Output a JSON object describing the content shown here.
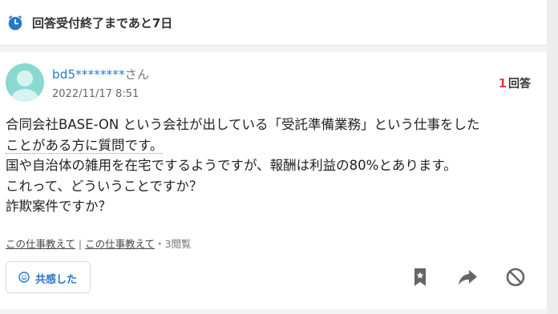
{
  "deadline": {
    "text": "回答受付終了まであと7日",
    "icon": "alarm-clock-icon",
    "icon_color": "#2878c8"
  },
  "question": {
    "user_name": "bd5********",
    "user_suffix": "さん",
    "posted_at": "2022/11/17 8:51",
    "answer_count": "1",
    "answer_label": "回答",
    "lines": [
      "合同会社BASE-ON という会社が出している「受託準備業務」という仕事をした",
      "ことがある方に質問です。",
      "国や自治体の雑用を在宅でするようですが、報酬は利益の80%とあります。",
      "これって、どういうことですか？",
      "詐欺案件ですか？"
    ],
    "tags": [
      "この仕事教えて",
      "この仕事教えて"
    ],
    "tag_separator": "|",
    "views": "・3閲覧",
    "empathy_label": "共感した"
  },
  "colors": {
    "accent_blue": "#2878c8",
    "count_red": "#ea3c3c",
    "avatar": "#89d9d0"
  },
  "actions": {
    "bookmark": "bookmark-icon",
    "share": "share-arrow-icon",
    "block": "block-icon"
  }
}
